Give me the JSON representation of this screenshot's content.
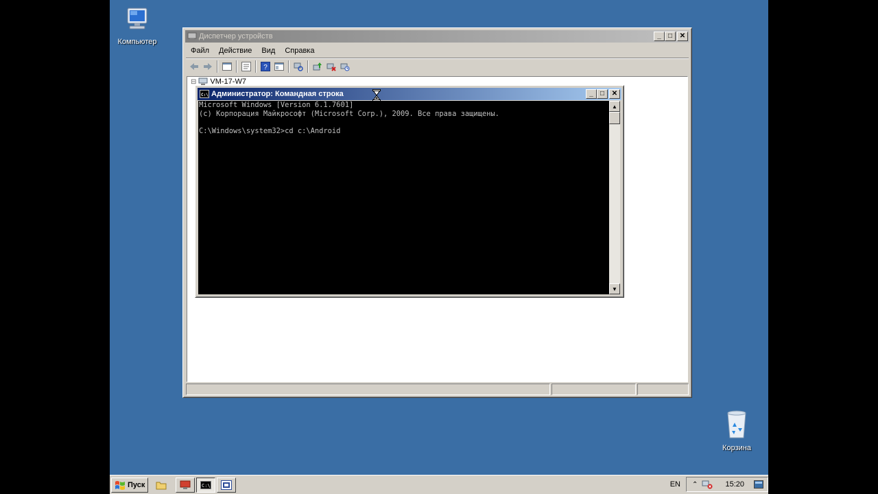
{
  "desktop": {
    "computer_label": "Компьютер",
    "recycle_label": "Корзина"
  },
  "devmgr": {
    "title": "Диспетчер устройств",
    "menu": [
      "Файл",
      "Действие",
      "Вид",
      "Справка"
    ],
    "tree_root": "VM-17-W7",
    "tree_toggle": "⊟"
  },
  "console": {
    "title": "Администратор: Командная строка",
    "lines": [
      "Microsoft Windows [Version 6.1.7601]",
      "(c) Корпорация Майкрософт (Microsoft Corp.), 2009. Все права защищены.",
      "",
      "C:\\Windows\\system32>cd c:\\Android"
    ]
  },
  "taskbar": {
    "start_label": "Пуск",
    "lang": "EN",
    "time": "15:20"
  },
  "colors": {
    "desktop": "#3a6ea5",
    "active_title": "#0a246a",
    "inactive_title": "#808080"
  },
  "icons": [
    "computer-icon",
    "recycle-bin-icon",
    "back-icon",
    "forward-icon",
    "console-icon",
    "hourglass-cursor-icon",
    "start-flag-icon",
    "show-desktop-icon",
    "device-manager-icon",
    "network-icon",
    "volume-icon"
  ]
}
